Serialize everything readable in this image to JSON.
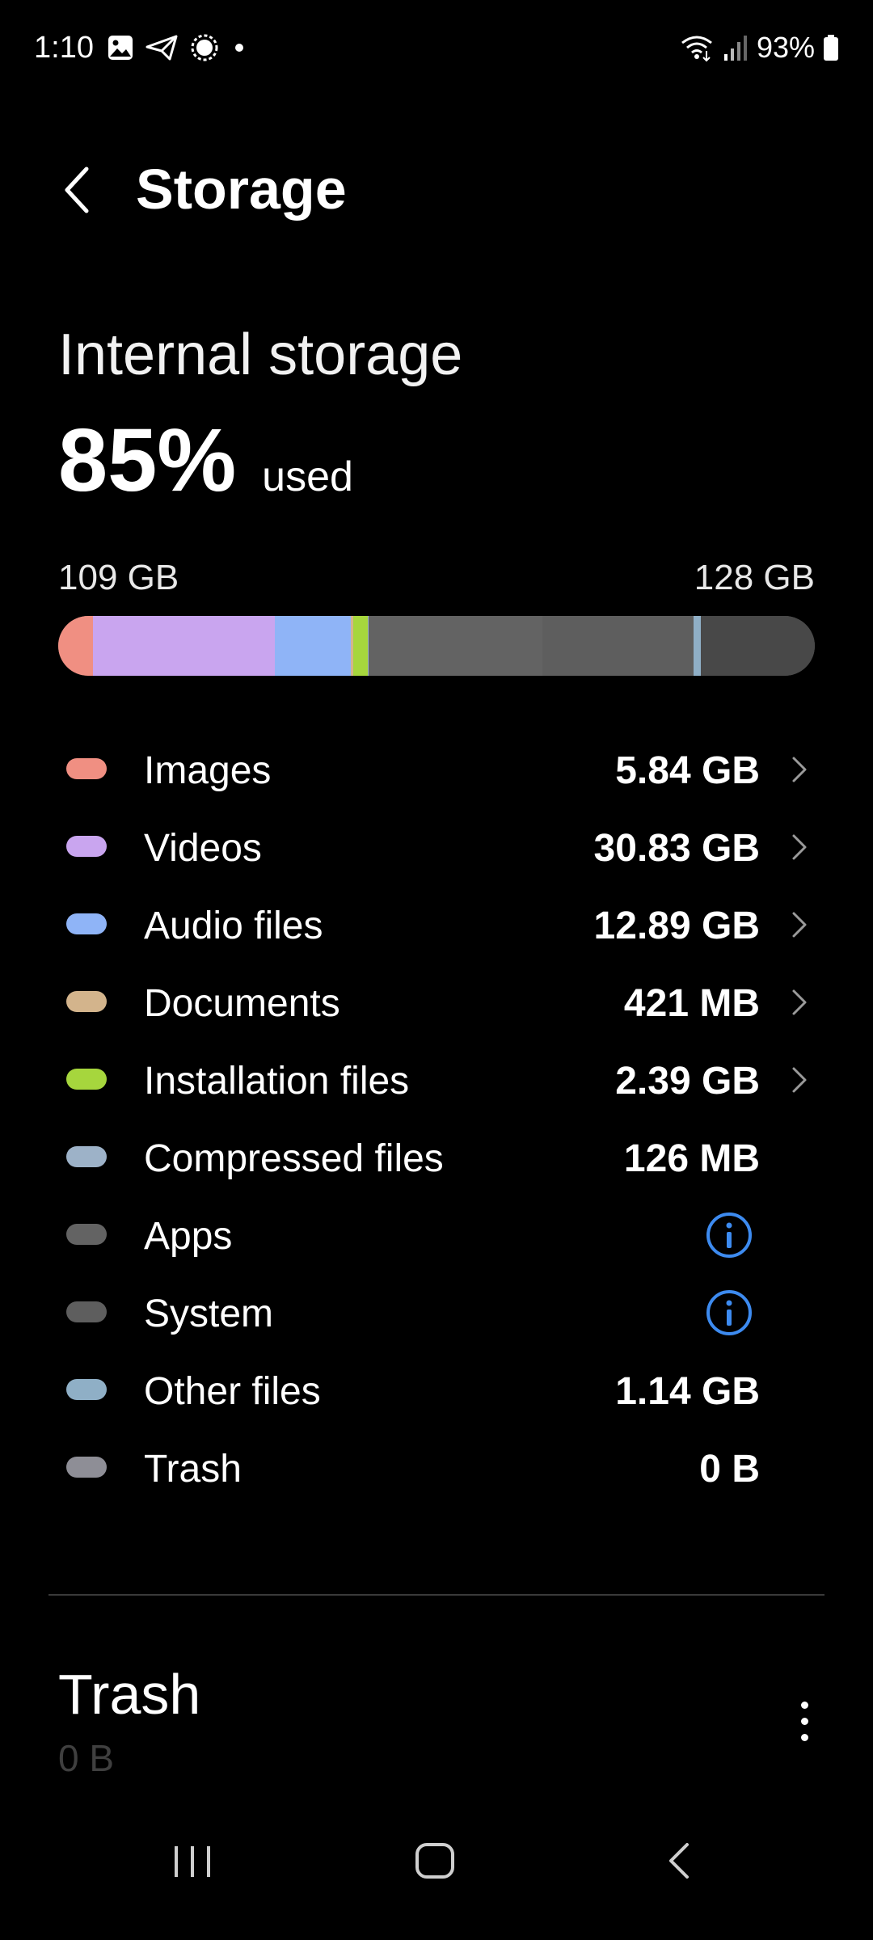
{
  "status_bar": {
    "time": "1:10",
    "battery": "93%"
  },
  "header": {
    "title": "Storage"
  },
  "internal_storage": {
    "label": "Internal storage",
    "used_percent": "85%",
    "used_word": "used",
    "used_capacity": "109 GB",
    "total_capacity": "128 GB"
  },
  "bar_segments": [
    {
      "name": "Images",
      "fraction": 0.0456,
      "color": "#f08f82"
    },
    {
      "name": "Videos",
      "fraction": 0.2409,
      "color": "#c9a5ef"
    },
    {
      "name": "Audio files",
      "fraction": 0.1007,
      "color": "#8fb4f7"
    },
    {
      "name": "Documents",
      "fraction": 0.0033,
      "color": "#d3b48c"
    },
    {
      "name": "Installation files",
      "fraction": 0.0187,
      "color": "#a6d63d"
    },
    {
      "name": "Compressed files",
      "fraction": 0.001,
      "color": "#9db2c8"
    },
    {
      "name": "Apps",
      "fraction": 0.23,
      "color": "#636363"
    },
    {
      "name": "System",
      "fraction": 0.2,
      "color": "#5e5e5e"
    },
    {
      "name": "Other files",
      "fraction": 0.0089,
      "color": "#8fafc6"
    },
    {
      "name": "Free",
      "fraction": 0.1509,
      "color": "#484848"
    }
  ],
  "categories": [
    {
      "label": "Images",
      "value": "5.84 GB",
      "color": "#f08f82",
      "chevron": true,
      "info": false
    },
    {
      "label": "Videos",
      "value": "30.83 GB",
      "color": "#c9a5ef",
      "chevron": true,
      "info": false
    },
    {
      "label": "Audio files",
      "value": "12.89 GB",
      "color": "#8fb4f7",
      "chevron": true,
      "info": false
    },
    {
      "label": "Documents",
      "value": "421 MB",
      "color": "#d3b48c",
      "chevron": true,
      "info": false
    },
    {
      "label": "Installation files",
      "value": "2.39 GB",
      "color": "#a6d63d",
      "chevron": true,
      "info": false
    },
    {
      "label": "Compressed files",
      "value": "126 MB",
      "color": "#9db2c8",
      "chevron": false,
      "info": false
    },
    {
      "label": "Apps",
      "value": "",
      "color": "#636363",
      "chevron": false,
      "info": true
    },
    {
      "label": "System",
      "value": "",
      "color": "#5e5e5e",
      "chevron": false,
      "info": true
    },
    {
      "label": "Other files",
      "value": "1.14 GB",
      "color": "#8fafc6",
      "chevron": false,
      "info": false
    },
    {
      "label": "Trash",
      "value": "0 B",
      "color": "#8e8e96",
      "chevron": false,
      "info": false
    }
  ],
  "trash_section": {
    "title": "Trash",
    "size": "0 B"
  },
  "colors": {
    "background": "#000000",
    "accent_info": "#3d8bf0"
  },
  "icons": {
    "status_left": [
      "gallery-icon",
      "send-icon",
      "signal-app-icon",
      "notification-dot-icon"
    ],
    "status_right": [
      "wifi-icon",
      "cellular-signal-icon",
      "battery-icon"
    ],
    "nav": [
      "recents-icon",
      "home-icon",
      "back-icon"
    ]
  }
}
